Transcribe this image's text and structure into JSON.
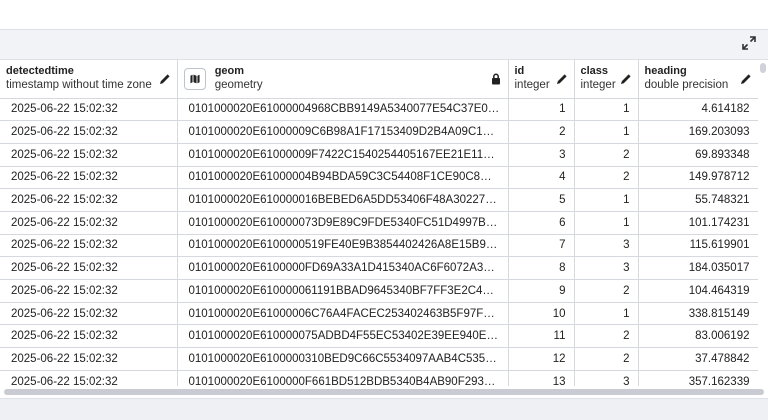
{
  "columns": [
    {
      "name": "detectedtime",
      "type": "timestamp without time zone",
      "icon": "pencil-icon"
    },
    {
      "name": "geom",
      "type": "geometry",
      "icon": "lock-icon"
    },
    {
      "name": "id",
      "type": "integer",
      "icon": "pencil-icon"
    },
    {
      "name": "class",
      "type": "integer",
      "icon": "pencil-icon"
    },
    {
      "name": "heading",
      "type": "double precision",
      "icon": "pencil-icon"
    }
  ],
  "rows": [
    {
      "detectedtime": "2025-06-22 15:02:32",
      "geom": "0101000020E61000004968CBB9149A5340077E54C37E072E…",
      "id": "1",
      "class": "1",
      "heading": "4.614182"
    },
    {
      "detectedtime": "2025-06-22 15:02:32",
      "geom": "0101000020E61000009C6B98A1F17153409D2B4A09C1F22C…",
      "id": "2",
      "class": "1",
      "heading": "169.203093"
    },
    {
      "detectedtime": "2025-06-22 15:02:32",
      "geom": "0101000020E61000009F7422C1540254405167EE21E1132B40",
      "id": "3",
      "class": "2",
      "heading": "69.893348"
    },
    {
      "detectedtime": "2025-06-22 15:02:32",
      "geom": "0101000020E61000004B94BDA59C3C54408F1CE90C8CBC2…",
      "id": "4",
      "class": "2",
      "heading": "149.978712"
    },
    {
      "detectedtime": "2025-06-22 15:02:32",
      "geom": "0101000020E610000016BEBED6A5DD53406F48A302271B2C…",
      "id": "5",
      "class": "1",
      "heading": "55.748321"
    },
    {
      "detectedtime": "2025-06-22 15:02:32",
      "geom": "0101000020E610000073D9E89C9FDE5340FC51D4997BC82A…",
      "id": "6",
      "class": "1",
      "heading": "101.174231"
    },
    {
      "detectedtime": "2025-06-22 15:02:32",
      "geom": "0101000020E6100000519FE40E9B3854402426A8E15B982640",
      "id": "7",
      "class": "3",
      "heading": "115.619901"
    },
    {
      "detectedtime": "2025-06-22 15:02:32",
      "geom": "0101000020E6100000FD69A33A1D415340AC6F6072A3D82C…",
      "id": "8",
      "class": "3",
      "heading": "184.035017"
    },
    {
      "detectedtime": "2025-06-22 15:02:32",
      "geom": "0101000020E610000061191BBAD9645340BF7FF3E2C4AF26…",
      "id": "9",
      "class": "2",
      "heading": "104.464319"
    },
    {
      "detectedtime": "2025-06-22 15:02:32",
      "geom": "0101000020E61000006C76A4FACEC253402463B5F97FC528…",
      "id": "10",
      "class": "1",
      "heading": "338.815149"
    },
    {
      "detectedtime": "2025-06-22 15:02:32",
      "geom": "0101000020E610000075ADBD4F55EC53402E39EE940EB626…",
      "id": "11",
      "class": "2",
      "heading": "83.006192"
    },
    {
      "detectedtime": "2025-06-22 15:02:32",
      "geom": "0101000020E6100000310BED9C66C5534097AAB4C5359E2B…",
      "id": "12",
      "class": "2",
      "heading": "37.478842"
    },
    {
      "detectedtime": "2025-06-22 15:02:32",
      "geom": "0101000020E6100000F661BD512BDB5340B4AB90F293C22A…",
      "id": "13",
      "class": "3",
      "heading": "357.162339"
    }
  ],
  "toolbar": {
    "expand_icon": "expand-icon"
  },
  "geom_header_icon": "map-icon"
}
